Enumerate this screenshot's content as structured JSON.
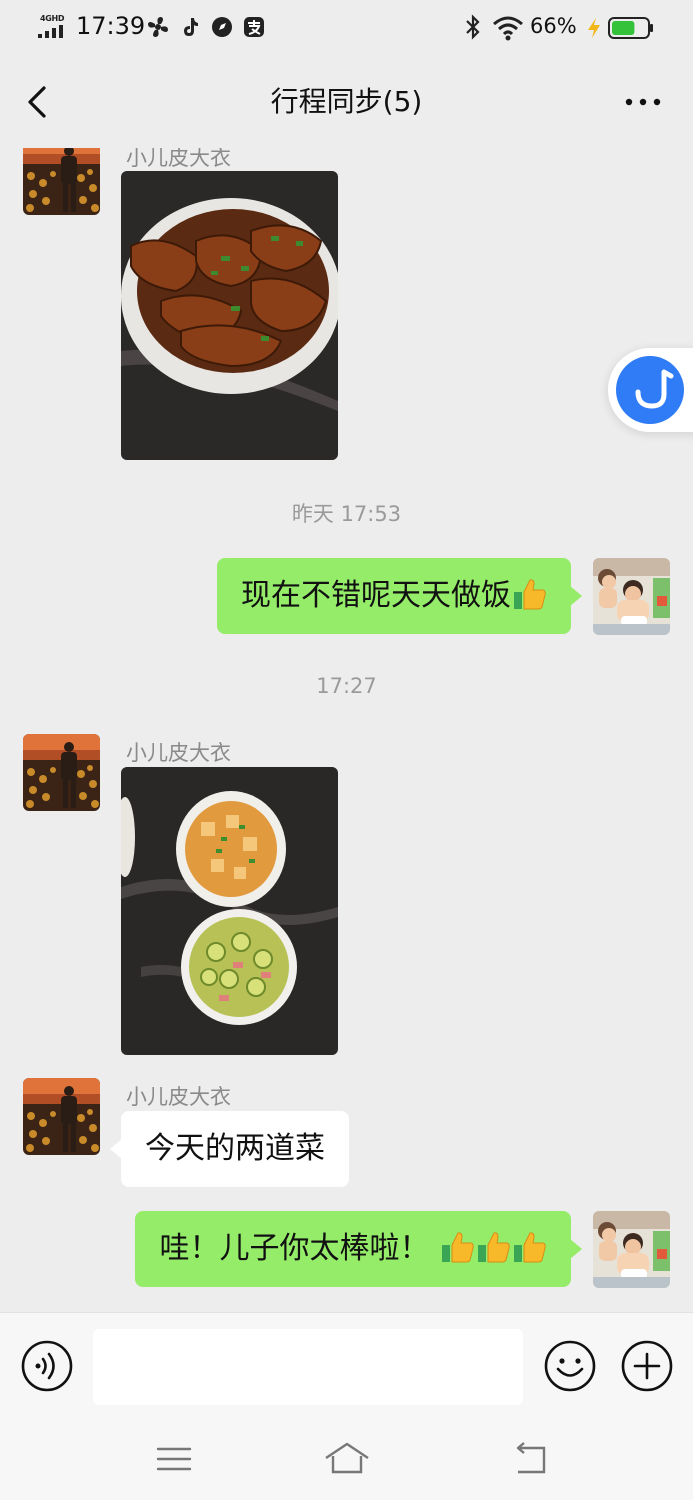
{
  "status_bar": {
    "network": "4GHD",
    "time": "17:39",
    "battery_percent": "66%",
    "battery_level": 0.66
  },
  "header": {
    "title": "行程同步(5)"
  },
  "messages": {
    "m1": {
      "sender": "小儿皮大衣",
      "type": "image"
    },
    "t1": "昨天 17:53",
    "m2": {
      "text": "现在不错呢天天做饭"
    },
    "t2": "17:27",
    "m3": {
      "sender": "小儿皮大衣",
      "type": "image"
    },
    "m4": {
      "sender": "小儿皮大衣",
      "text": "今天的两道菜"
    },
    "m5": {
      "text": "哇！儿子你太棒啦！"
    }
  },
  "input": {
    "value": "",
    "placeholder": ""
  },
  "colors": {
    "outgoing_bubble": "#95ec69",
    "incoming_bubble": "#ffffff",
    "background": "#ededed"
  }
}
